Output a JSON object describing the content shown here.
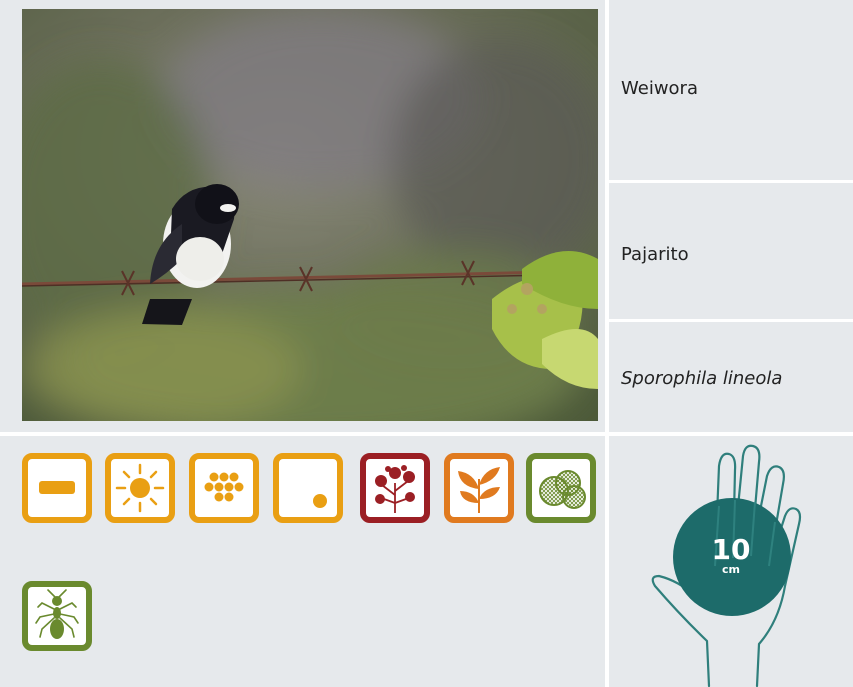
{
  "names": {
    "local_name": "Weiwora",
    "common_name": "Pajarito",
    "scientific_name": "Sporophila lineola"
  },
  "size": {
    "value": "10",
    "unit": "cm"
  },
  "icons": [
    {
      "name": "horizontal-bar-icon",
      "color": "#e99f13"
    },
    {
      "name": "sun-icon",
      "color": "#e99f13"
    },
    {
      "name": "dot-cluster-icon",
      "color": "#e99f13"
    },
    {
      "name": "single-dot-icon",
      "color": "#e99f13"
    },
    {
      "name": "flowering-tree-icon",
      "color": "#9b1f24"
    },
    {
      "name": "leaves-icon",
      "color": "#e07a1f"
    },
    {
      "name": "seeds-icon",
      "color": "#6a8a2e"
    },
    {
      "name": "ant-icon",
      "color": "#6a8a2e"
    }
  ],
  "colors": {
    "panel_background": "#e6e9ec",
    "hand_circle": "#1d6b6a",
    "hand_outline": "#2f7f7c"
  }
}
